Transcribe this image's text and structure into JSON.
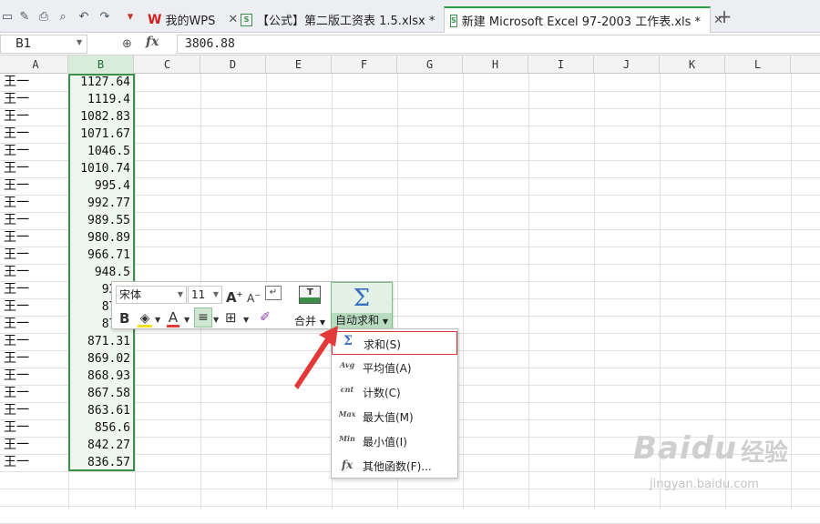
{
  "tabs": {
    "wps_home": "我的WPS",
    "doc1": "【公式】第二版工资表 1.5.xlsx *",
    "doc2": "新建 Microsoft Excel 97-2003 工作表.xls *",
    "close": "✕",
    "new": "+"
  },
  "formula_bar": {
    "cell_ref": "B1",
    "fx": "fx",
    "value": "3806.88"
  },
  "columns": [
    "A",
    "B",
    "C",
    "D",
    "E",
    "F",
    "G",
    "H",
    "I",
    "J",
    "K",
    "L"
  ],
  "selected_column": "B",
  "rows": [
    {
      "name": "王一",
      "value": "1127.64"
    },
    {
      "name": "王一",
      "value": "1119.4"
    },
    {
      "name": "王一",
      "value": "1082.83"
    },
    {
      "name": "王一",
      "value": "1071.67"
    },
    {
      "name": "王一",
      "value": "1046.5"
    },
    {
      "name": "王一",
      "value": "1010.74"
    },
    {
      "name": "王一",
      "value": "995.4"
    },
    {
      "name": "王一",
      "value": "992.77"
    },
    {
      "name": "王一",
      "value": "989.55"
    },
    {
      "name": "王一",
      "value": "980.89"
    },
    {
      "name": "王一",
      "value": "966.71"
    },
    {
      "name": "王一",
      "value": "948.5"
    },
    {
      "name": "王一",
      "value": "931."
    },
    {
      "name": "王一",
      "value": "877."
    },
    {
      "name": "王一",
      "value": "873."
    },
    {
      "name": "王一",
      "value": "871.31"
    },
    {
      "name": "王一",
      "value": "869.02"
    },
    {
      "name": "王一",
      "value": "868.93"
    },
    {
      "name": "王一",
      "value": "867.58"
    },
    {
      "name": "王一",
      "value": "863.61"
    },
    {
      "name": "王一",
      "value": "856.6"
    },
    {
      "name": "王一",
      "value": "842.27"
    },
    {
      "name": "王一",
      "value": "836.57"
    }
  ],
  "mini_toolbar": {
    "font_name": "宋体",
    "font_size": "11",
    "grow_font": "A",
    "shrink_font": "A",
    "bold": "B",
    "font_color": "A",
    "merge": "合并",
    "autosum": "自动求和",
    "sigma": "Σ"
  },
  "function_menu": [
    {
      "icon": "Σ",
      "label": "求和(S)"
    },
    {
      "icon": "Avg",
      "label": "平均值(A)"
    },
    {
      "icon": "cnt",
      "label": "计数(C)"
    },
    {
      "icon": "Max",
      "label": "最大值(M)"
    },
    {
      "icon": "Min",
      "label": "最小值(I)"
    },
    {
      "icon": "fx",
      "label": "其他函数(F)..."
    }
  ],
  "watermark": {
    "logo": "Baidu",
    "cn": "经验",
    "url": "jingyan.baidu.com"
  },
  "colors": {
    "accent_green": "#3c8f48",
    "annotation_red": "#e23a3a",
    "selection_fill": "#eef6ef"
  }
}
